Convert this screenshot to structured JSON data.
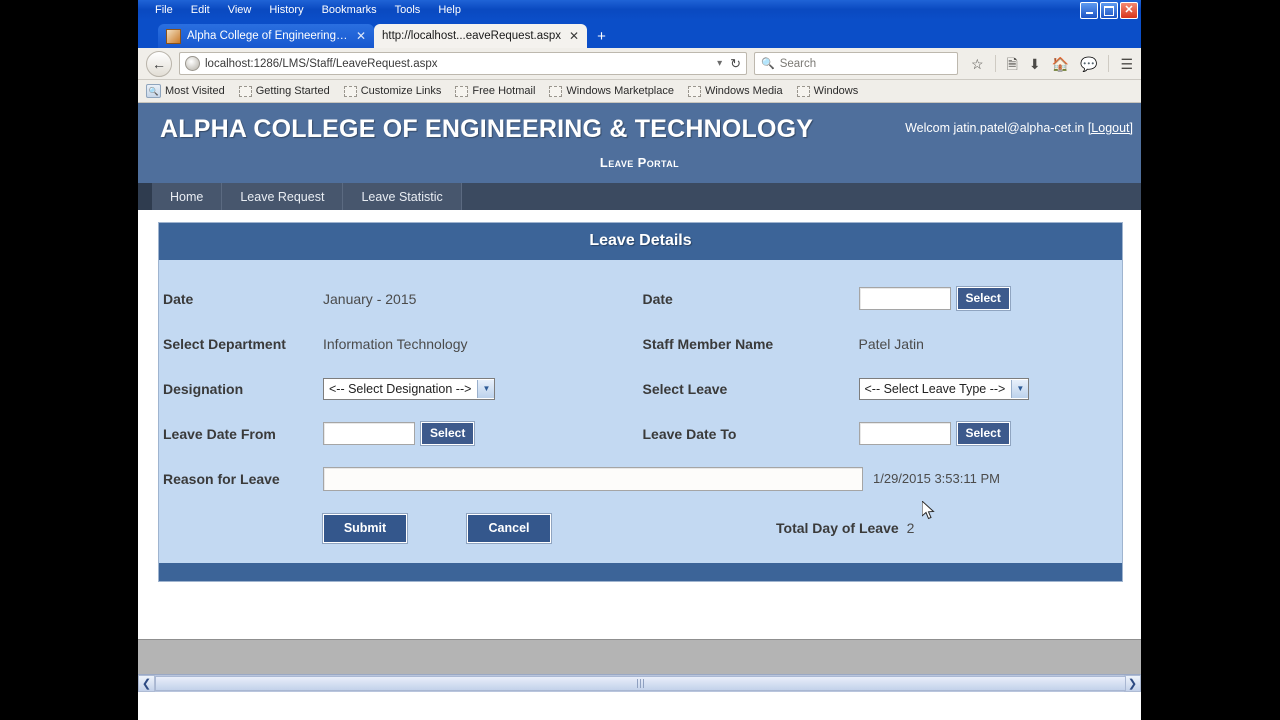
{
  "browser": {
    "menu": [
      "File",
      "Edit",
      "View",
      "History",
      "Bookmarks",
      "Tools",
      "Help"
    ],
    "window_controls": {
      "minimize": "minimize-button",
      "maximize": "restore-button",
      "close": "close-button"
    },
    "tabs": [
      {
        "title": "Alpha College of Engineering ...",
        "active": false
      },
      {
        "title": "http://localhost...eaveRequest.aspx",
        "active": true
      }
    ],
    "new_tab_label": "+",
    "url": "localhost:1286/LMS/Staff/LeaveRequest.aspx",
    "url_host": "localhost:1286",
    "url_path": "/LMS/Staff/LeaveRequest.aspx",
    "search_placeholder": "Search",
    "bookmarks": [
      "Most Visited",
      "Getting Started",
      "Customize Links",
      "Free Hotmail",
      "Windows Marketplace",
      "Windows Media",
      "Windows"
    ],
    "toolbar_icons": [
      "bookmark-star-icon",
      "reading-list-icon",
      "downloads-icon",
      "home-icon",
      "chat-icon",
      "menu-hamburger-icon"
    ]
  },
  "site": {
    "title": "ALPHA COLLEGE OF ENGINEERING & TECHNOLOGY",
    "welcome_text": "Welcom jatin.patel@alpha-cet.in",
    "logout_label": "[Logout]",
    "subtitle": "Leave Portal",
    "nav": [
      "Home",
      "Leave Request",
      "Leave Statistic"
    ]
  },
  "panel": {
    "title": "Leave Details",
    "fields": {
      "date_left_label": "Date",
      "date_left_value": "January - 2015",
      "date_right_label": "Date",
      "date_right_value": "",
      "date_right_button": "Select",
      "department_label": "Select Department",
      "department_value": "Information Technology",
      "staff_label": "Staff Member Name",
      "staff_value": "Patel Jatin",
      "designation_label": "Designation",
      "designation_value": "<-- Select Designation -->",
      "leave_label": "Select Leave",
      "leave_value": "<-- Select Leave Type -->",
      "leave_from_label": "Leave Date From",
      "leave_from_value": "",
      "leave_from_button": "Select",
      "leave_to_label": "Leave Date To",
      "leave_to_value": "",
      "leave_to_button": "Select",
      "reason_label": "Reason for Leave",
      "reason_value": "",
      "timestamp": "1/29/2015 3:53:11 PM",
      "total_label": "Total Day of Leave",
      "total_value": "2"
    },
    "buttons": {
      "submit": "Submit",
      "cancel": "Cancel"
    }
  },
  "colors": {
    "header_blue": "#4f6f9c",
    "panel_blue": "#3c6498",
    "form_bg": "#c3d9f2",
    "nav_bar": "#3b4a60",
    "button_blue": "#34578c"
  }
}
